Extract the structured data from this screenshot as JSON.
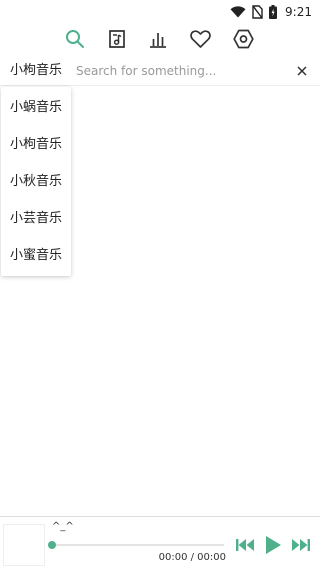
{
  "status_bar": {
    "time": "9:21",
    "icons": [
      "wifi-icon",
      "no-sim-icon",
      "battery-icon"
    ]
  },
  "nav": {
    "tabs": [
      {
        "name": "search",
        "icon": "search-icon",
        "active": true
      },
      {
        "name": "local-music",
        "icon": "music-file-icon",
        "active": false
      },
      {
        "name": "charts",
        "icon": "bar-chart-icon",
        "active": false
      },
      {
        "name": "favorites",
        "icon": "heart-icon",
        "active": false
      },
      {
        "name": "settings",
        "icon": "settings-icon",
        "active": false
      }
    ]
  },
  "search": {
    "source_label": "小枸音乐",
    "placeholder": "Search for something...",
    "value": "",
    "clear_icon": "close-icon"
  },
  "dropdown": {
    "options": [
      "小蜗音乐",
      "小枸音乐",
      "小秋音乐",
      "小芸音乐",
      "小蜜音乐"
    ]
  },
  "player": {
    "title": "^_^",
    "time_text": "00:00 / 00:00",
    "progress": 0,
    "controls": [
      "previous-icon",
      "play-icon",
      "next-icon"
    ]
  },
  "colors": {
    "accent": "#4fb08b",
    "text": "#222222",
    "placeholder": "#999999"
  }
}
